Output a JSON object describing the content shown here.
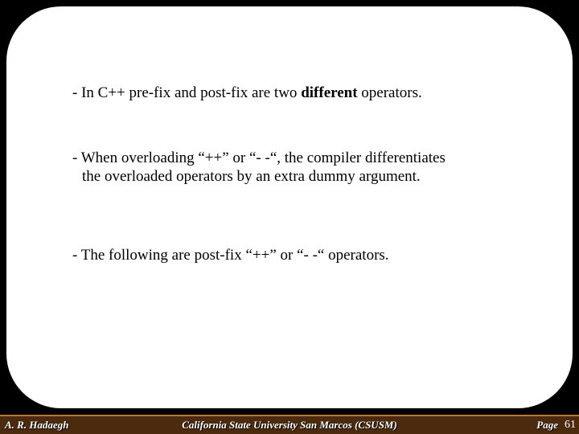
{
  "body": {
    "p1_a": "- In C++ pre-fix and post-fix are two ",
    "p1_b": "different",
    "p1_c": " operators.",
    "p2_l1": "- When overloading “++” or “- -“, the compiler differentiates",
    "p2_l2": "the overloaded operators by an extra dummy argument.",
    "p3": "- The following are post-fix “++” or “- -“ operators."
  },
  "footer": {
    "author": "A. R. Hadaegh",
    "institution": "California State University San Marcos (CSUSM)",
    "page_label": "Page",
    "page_num": "61"
  }
}
